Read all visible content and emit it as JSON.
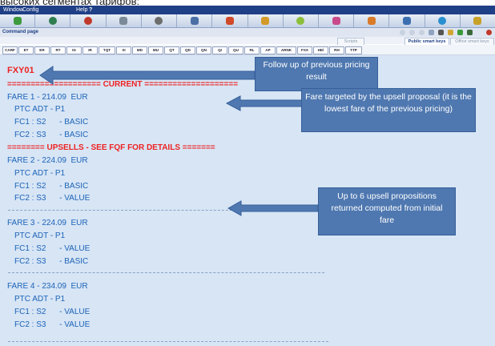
{
  "caption": "высоких сегментах тарифов:",
  "menu": {
    "window": "Window",
    "config": "Config",
    "help": "Help",
    "help_mark": "?"
  },
  "icons": [
    "home-icon",
    "globe-icon",
    "user-icon",
    "cards-icon",
    "gear-icon",
    "car-icon",
    "person-icon",
    "pen-icon",
    "flower-icon",
    "note-icon",
    "people-icon",
    "document-icon",
    "info-icon",
    "chart-icon"
  ],
  "command_page_label": "Command page",
  "tabs": {
    "scripts": "Scripts",
    "public": "Public smart keys",
    "office": "Office smart keys"
  },
  "smart_keys": [
    "CARF",
    "ET",
    "ER",
    "RT",
    "IG",
    "IR",
    "TQT",
    "XI",
    "MD",
    "MU",
    "QT",
    "QD",
    "QN",
    "QI",
    "QU",
    "RL",
    "AP",
    "ARNK",
    "FXX",
    "HE/",
    "RH",
    "TTP"
  ],
  "terminal": {
    "title": "FXY01",
    "current_header": "==================== CURRENT ====================",
    "upsell_header": "======== UPSELLS - SEE FQF FOR DETAILS =======",
    "fares": [
      {
        "fare": "FARE 1 - 214.09  EUR",
        "ptc": "PTC ADT - P1",
        "fc1": "FC1 : S2      - BASIC",
        "fc2": "FC2 : S3      - BASIC"
      },
      {
        "fare": "FARE 2 - 224.09  EUR",
        "ptc": "PTC ADT - P1",
        "fc1": "FC1 : S2      - BASIC",
        "fc2": "FC2 : S3      - VALUE"
      },
      {
        "fare": "FARE 3 - 224.09  EUR",
        "ptc": "PTC ADT - P1",
        "fc1": "FC1 : S2      - VALUE",
        "fc2": "FC2 : S3      - BASIC"
      },
      {
        "fare": "FARE 4 - 234.09  EUR",
        "ptc": "PTC ADT - P1",
        "fc1": "FC1 : S2      - VALUE",
        "fc2": "FC2 : S3      - VALUE"
      }
    ]
  },
  "callouts": {
    "follow_up": "Follow up of previous pricing result",
    "fare_targeted": "Fare targeted by the upsell proposal (it is the lowest fare of the previous pricing)",
    "upsell_props": "Up to 6 upsell propositions returned computed from initial fare"
  },
  "colors": {
    "callout": "#4f78b0",
    "terminal_bg": "#d7e5f5",
    "header_red": "#ee2222",
    "text_blue": "#1d63b8"
  }
}
